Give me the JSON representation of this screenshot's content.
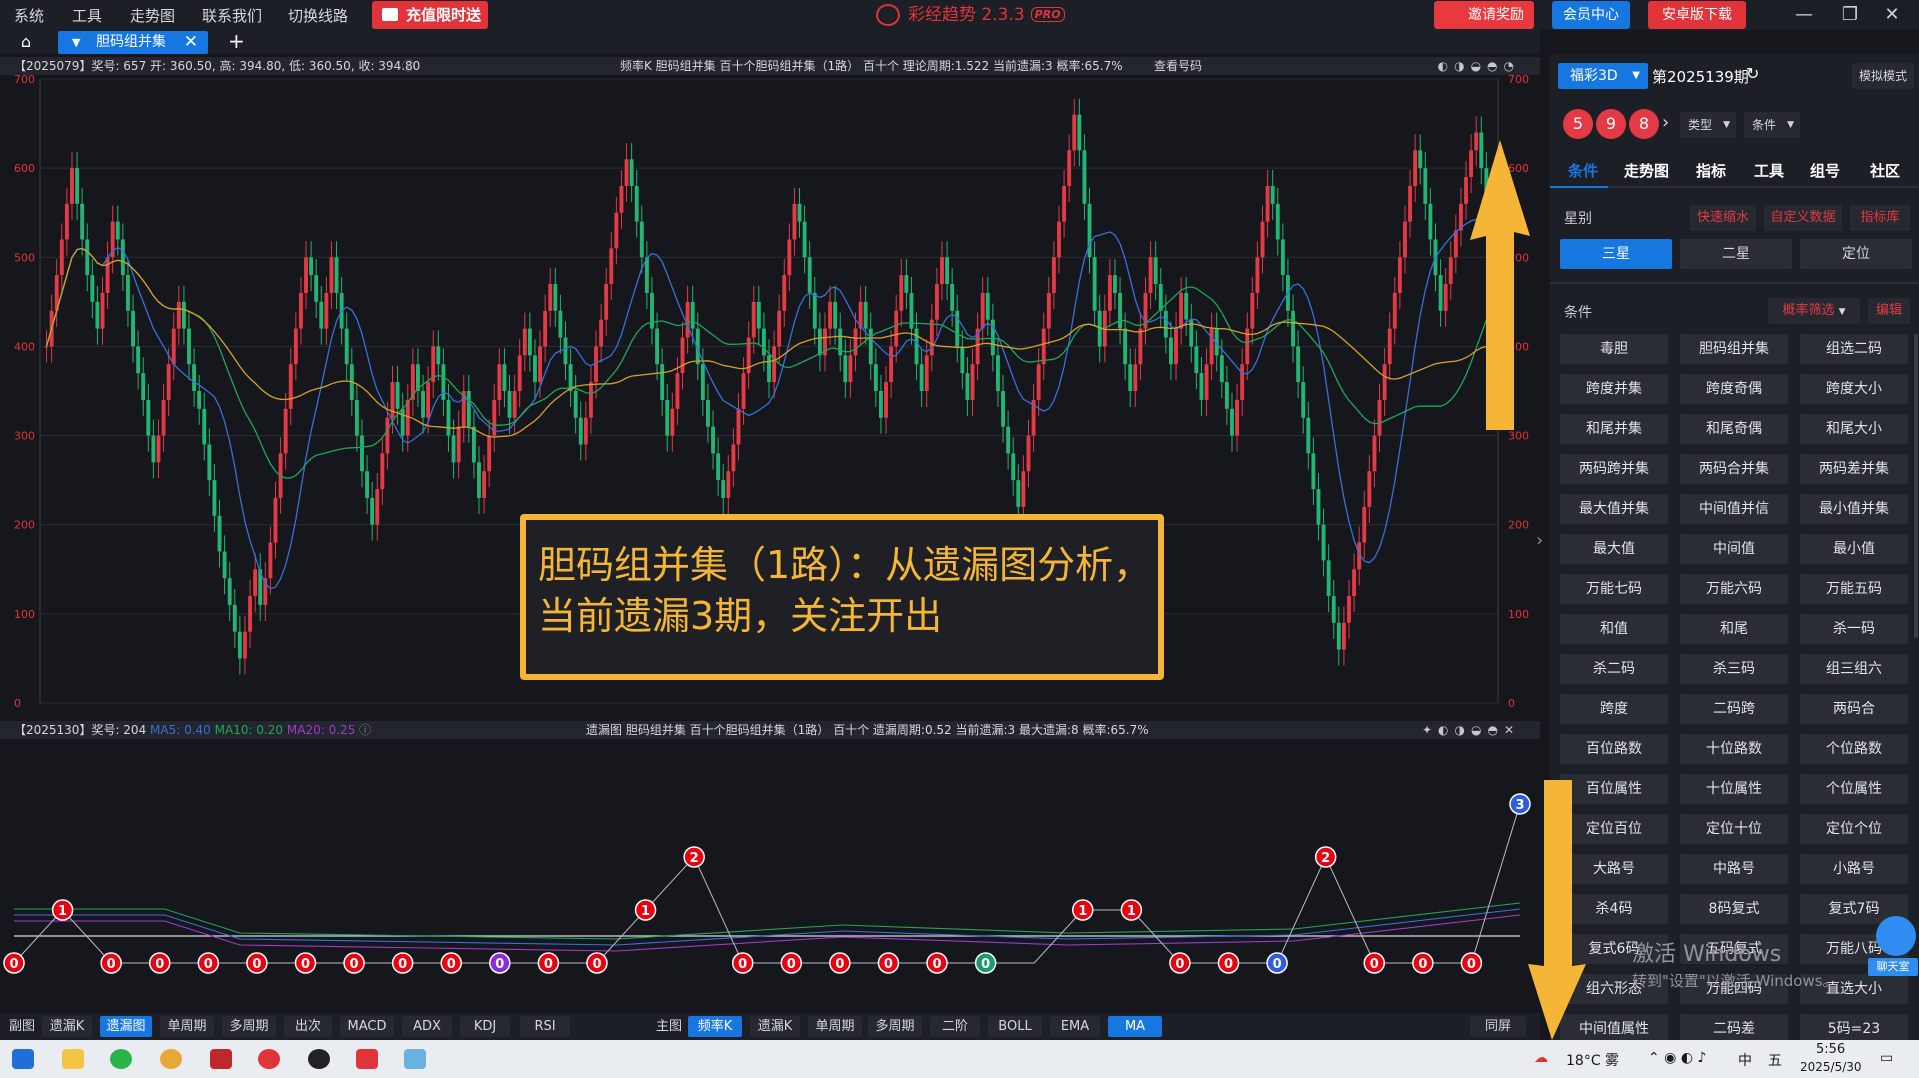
{
  "menu": [
    "系统",
    "工具",
    "走势图",
    "联系我们",
    "切换线路"
  ],
  "promo": "充值限时送",
  "app_title": "彩经趋势 2.3.3",
  "app_badge": "PRO",
  "top_buttons": {
    "invite": "邀请奖励",
    "member": "会员中心",
    "android": "安卓版下载"
  },
  "colors": {
    "accent": "#1677e0",
    "red": "#e33a45",
    "green": "#22b573",
    "gold": "#f5b536",
    "bg": "#15171c",
    "panel": "#1c1f25"
  },
  "tab": {
    "label": "胆码组并集"
  },
  "main_info": {
    "left": "【2025079】奖号: 657  开: 360.50, 高: 394.80, 低: 360.50, 收: 394.80",
    "mid": "频率K  胆码组并集  百十个胆码组并集（1路）  百十个  理论周期:1.522  当前遗漏:3  概率:65.7%",
    "link": "查看号码"
  },
  "sub_info": {
    "left": "【2025130】奖号: 204",
    "ma5": "MA5: 0.40",
    "ma10": "MA10: 0.20",
    "ma20": "MA20: 0.25",
    "mid": "遗漏图  胆码组并集  百十个胆码组并集（1路）  百十个  遗漏周期:0.52  当前遗漏:3  最大遗漏:8  概率:65.7%"
  },
  "annotation": [
    "胆码组并集（1路）：从遗漏图分析，",
    "当前遗漏3期，关注开出"
  ],
  "chart_data": [
    {
      "type": "candlestick",
      "title": "频率K 胆码组并集",
      "ylim": [
        0,
        700
      ],
      "yticks": [
        0,
        100,
        200,
        300,
        400,
        500,
        600,
        700
      ],
      "x": [
        1,
        2,
        3,
        4,
        5,
        6,
        7,
        8,
        9,
        10,
        11,
        12,
        13,
        14,
        15,
        16,
        17,
        18,
        19,
        20,
        21,
        22,
        23,
        24,
        25,
        26,
        27,
        28,
        29,
        30,
        31,
        32,
        33,
        34,
        35,
        36,
        37,
        38,
        39,
        40,
        41,
        42,
        43,
        44,
        45,
        46,
        47,
        48,
        49,
        50,
        51,
        52,
        53,
        54,
        55,
        56,
        57,
        58,
        59,
        60,
        61,
        62,
        63,
        64,
        65,
        66,
        67,
        68,
        69,
        70,
        71,
        72,
        73,
        74,
        75,
        76,
        77,
        78,
        79,
        80,
        81,
        82,
        83,
        84,
        85,
        86,
        87,
        88,
        89,
        90,
        91,
        92,
        93,
        94,
        95,
        96,
        97,
        98,
        99,
        100,
        101,
        102,
        103,
        104,
        105,
        106,
        107,
        108,
        109,
        110,
        111,
        112,
        113,
        114,
        115,
        116,
        117,
        118,
        119,
        120,
        121,
        122,
        123,
        124,
        125,
        126,
        127,
        128,
        129,
        130,
        131,
        132,
        133,
        134,
        135,
        136,
        137,
        138,
        139,
        140,
        141,
        142,
        143,
        144,
        145,
        146,
        147,
        148,
        149,
        150,
        151,
        152,
        153,
        154,
        155,
        156,
        157,
        158,
        159,
        160,
        161,
        162,
        163,
        164,
        165,
        166,
        167,
        168,
        169,
        170,
        171,
        172,
        173,
        174,
        175,
        176,
        177,
        178,
        179,
        180,
        181,
        182,
        183,
        184,
        185,
        186,
        187,
        188,
        189,
        190,
        191,
        192,
        193,
        194,
        195,
        196,
        197,
        198,
        199,
        200,
        201,
        202,
        203,
        204,
        205,
        206,
        207,
        208,
        209,
        210,
        211,
        212,
        213,
        214,
        215,
        216,
        217,
        218,
        219,
        220,
        221,
        222,
        223,
        224,
        225,
        226,
        227,
        228,
        229,
        230,
        231,
        232,
        233,
        234,
        235,
        236,
        237,
        238,
        239,
        240,
        241,
        242,
        243,
        244,
        245,
        246,
        247,
        248,
        249,
        250,
        251,
        252,
        253,
        254,
        255,
        256,
        257,
        258,
        259,
        260,
        261,
        262,
        263,
        264,
        265,
        266,
        267,
        268,
        269,
        270,
        271,
        272,
        273,
        274,
        275,
        276,
        277,
        278,
        279,
        280,
        281,
        282,
        283,
        284,
        285,
        286,
        287,
        288,
        289,
        290,
        291,
        292,
        293,
        294,
        295,
        296,
        297,
        298,
        299,
        300
      ],
      "close": [
        400,
        440,
        480,
        520,
        560,
        600,
        560,
        520,
        480,
        450,
        420,
        460,
        500,
        540,
        520,
        480,
        440,
        400,
        370,
        340,
        300,
        270,
        300,
        340,
        380,
        420,
        450,
        420,
        380,
        350,
        330,
        290,
        250,
        210,
        170,
        140,
        110,
        80,
        50,
        80,
        120,
        150,
        110,
        140,
        180,
        230,
        280,
        330,
        380,
        420,
        460,
        500,
        480,
        450,
        420,
        460,
        500,
        460,
        420,
        380,
        340,
        300,
        260,
        230,
        200,
        240,
        280,
        320,
        360,
        330,
        300,
        340,
        380,
        350,
        320,
        360,
        400,
        380,
        340,
        300,
        270,
        310,
        350,
        310,
        270,
        230,
        260,
        300,
        340,
        380,
        350,
        320,
        350,
        390,
        420,
        390,
        360,
        400,
        440,
        470,
        440,
        410,
        380,
        350,
        320,
        290,
        320,
        360,
        400,
        430,
        470,
        510,
        550,
        580,
        610,
        580,
        540,
        500,
        460,
        420,
        380,
        340,
        300,
        330,
        370,
        410,
        450,
        420,
        380,
        340,
        310,
        280,
        250,
        230,
        260,
        290,
        330,
        370,
        410,
        450,
        420,
        390,
        360,
        400,
        440,
        480,
        520,
        560,
        540,
        500,
        460,
        420,
        390,
        420,
        450,
        420,
        390,
        360,
        390,
        420,
        450,
        420,
        380,
        350,
        320,
        360,
        400,
        440,
        480,
        460,
        420,
        380,
        350,
        390,
        430,
        470,
        500,
        470,
        440,
        400,
        370,
        340,
        380,
        420,
        460,
        430,
        390,
        350,
        310,
        280,
        250,
        220,
        260,
        300,
        340,
        380,
        420,
        460,
        500,
        540,
        580,
        620,
        660,
        620,
        560,
        500,
        440,
        400,
        440,
        480,
        460,
        420,
        380,
        350,
        380,
        420,
        460,
        500,
        470,
        440,
        410,
        380,
        420,
        460,
        430,
        400,
        370,
        340,
        380,
        420,
        390,
        360,
        330,
        300,
        340,
        380,
        420,
        460,
        500,
        540,
        580,
        560,
        520,
        480,
        440,
        400,
        360,
        320,
        280,
        240,
        200,
        160,
        120,
        90,
        60,
        90,
        120,
        150,
        180,
        220,
        260,
        300,
        340,
        380,
        420,
        460,
        500,
        540,
        580,
        620,
        600,
        560,
        520,
        480,
        440,
        470,
        500,
        530,
        560,
        590,
        620,
        640,
        600,
        560,
        500
      ],
      "series": [
        {
          "name": "MA5",
          "color": "#3a6fd8"
        },
        {
          "name": "MA10",
          "color": "#1fa65a"
        },
        {
          "name": "MA20",
          "color": "#d6a02a"
        }
      ]
    },
    {
      "type": "line",
      "title": "遗漏图",
      "xlabel": "",
      "ylabel": "",
      "values": [
        0,
        1,
        0,
        0,
        0,
        0,
        0,
        0,
        0,
        0,
        0,
        0,
        0,
        1,
        2,
        0,
        0,
        0,
        0,
        0,
        0,
        0,
        1,
        1,
        0,
        0,
        0,
        2,
        0,
        0,
        0,
        3
      ],
      "point_colors": [
        "red",
        "red",
        "red",
        "red",
        "red",
        "red",
        "red",
        "red",
        "red",
        "red",
        "purple",
        "red",
        "red",
        "red",
        "red",
        "red",
        "red",
        "red",
        "red",
        "red",
        "green",
        "none",
        "red",
        "red",
        "red",
        "red",
        "blue",
        "red",
        "red",
        "red",
        "red",
        "blue"
      ],
      "series": [
        {
          "name": "MA5",
          "value": "0.40",
          "color": "#3a6fd8"
        },
        {
          "name": "MA10",
          "value": "0.20",
          "color": "#1fa65a"
        },
        {
          "name": "MA20",
          "value": "0.25",
          "color": "#a03acc"
        }
      ]
    }
  ],
  "toolbar": {
    "sub_label": "副图",
    "sub_items": [
      "遗漏K",
      "遗漏图",
      "单周期",
      "多周期",
      "出次",
      "MACD",
      "ADX",
      "KDJ",
      "RSI"
    ],
    "main_label": "主图",
    "main_items": [
      "频率K",
      "遗漏K",
      "单周期",
      "多周期",
      "二阶",
      "BOLL",
      "EMA",
      "MA"
    ],
    "sync": "同屏"
  },
  "right": {
    "lottery": "福彩3D",
    "period": "第2025139期",
    "mode": "模拟模式",
    "balls": [
      "5",
      "9",
      "8"
    ],
    "type_select": "类型",
    "cond_select": "条件",
    "tabs": [
      "条件",
      "走势图",
      "指标",
      "工具",
      "组号",
      "社区"
    ],
    "star_label": "星别",
    "star_links": [
      "快速缩水",
      "自定义数据",
      "指标库"
    ],
    "stars": [
      "三星",
      "二星",
      "定位"
    ],
    "cond_label": "条件",
    "filter": "概率筛选",
    "edit": "编辑",
    "conditions": [
      "毒胆",
      "胆码组并集",
      "组选二码",
      "跨度并集",
      "跨度奇偶",
      "跨度大小",
      "和尾并集",
      "和尾奇偶",
      "和尾大小",
      "两码跨并集",
      "两码合并集",
      "两码差并集",
      "最大值并集",
      "中间值并信",
      "最小值并集",
      "最大值",
      "中间值",
      "最小值",
      "万能七码",
      "万能六码",
      "万能五码",
      "和值",
      "和尾",
      "杀一码",
      "杀二码",
      "杀三码",
      "组三组六",
      "跨度",
      "二码跨",
      "两码合",
      "百位路数",
      "十位路数",
      "个位路数",
      "百位属性",
      "十位属性",
      "个位属性",
      "定位百位",
      "定位十位",
      "定位个位",
      "大路号",
      "中路号",
      "小路号",
      "杀4码",
      "8码复式",
      "复式7码",
      "复式6码",
      "五码复式",
      "万能八码",
      "组六形态",
      "万能四码",
      "直选大小",
      "中间值属性",
      "二码差",
      "5码=23"
    ],
    "chat": "聊天室"
  },
  "watermark": {
    "line1": "激活 Windows",
    "line2": "转到\"设置\"以激活 Windows。"
  },
  "taskbar": {
    "weather": "18°C  雾",
    "time": "5:56",
    "date": "2025/5/30",
    "ime1": "中",
    "ime2": "五"
  }
}
